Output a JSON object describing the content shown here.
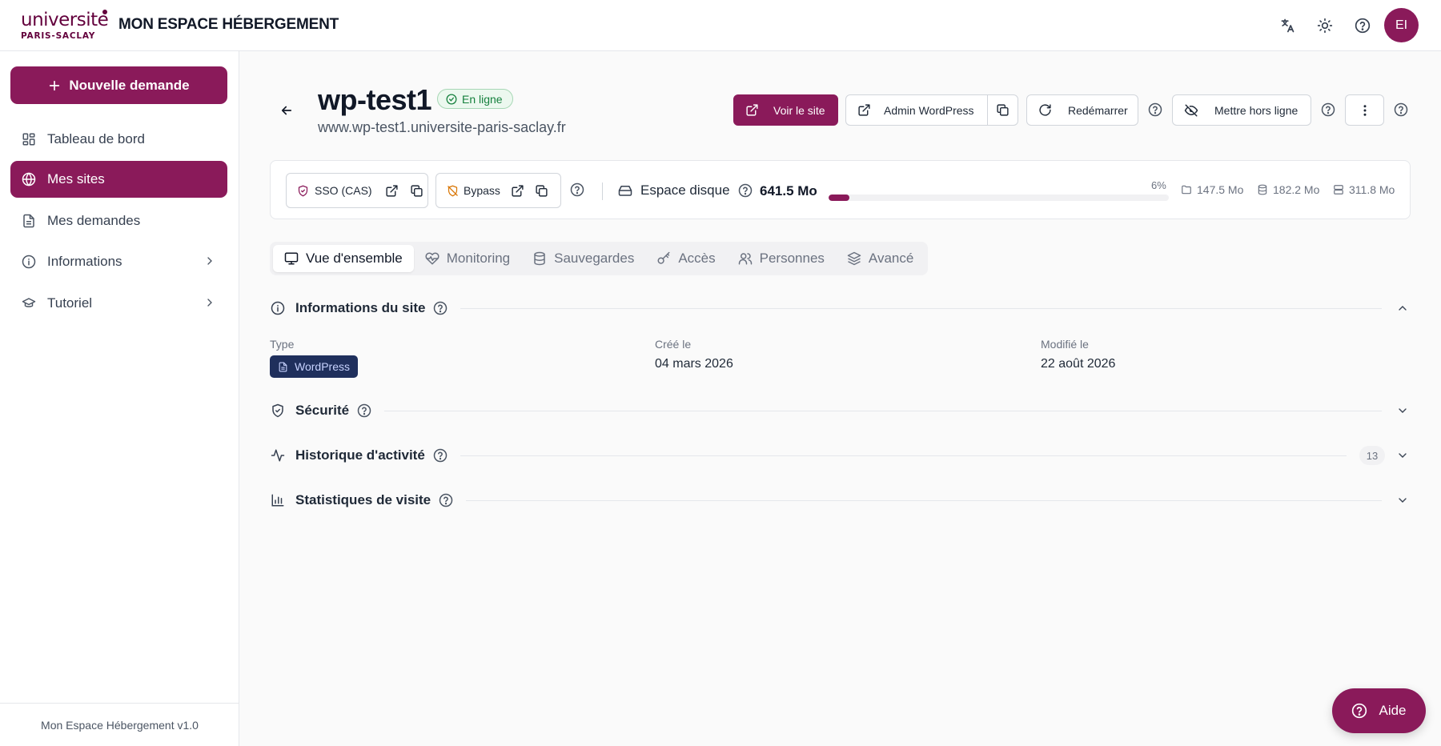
{
  "header": {
    "logo_top": "universite",
    "logo_bottom": "PARIS-SACLAY",
    "app_title": "MON ESPACE HÉBERGEMENT",
    "icons": [
      "translate-icon",
      "theme-icon",
      "help-icon"
    ],
    "avatar_initials": "EI"
  },
  "sidebar": {
    "new_request": "Nouvelle demande",
    "items": [
      {
        "label": "Tableau de bord",
        "icon": "dashboard-icon"
      },
      {
        "label": "Mes sites",
        "icon": "globe-icon",
        "active": true
      },
      {
        "label": "Mes demandes",
        "icon": "document-icon"
      },
      {
        "label": "Informations",
        "icon": "info-icon",
        "expandable": true
      },
      {
        "label": "Tutoriel",
        "icon": "graduation-icon",
        "expandable": true
      }
    ],
    "footer": "Mon Espace Hébergement v1.0"
  },
  "site": {
    "name": "wp-test1",
    "status": "En ligne",
    "url": "www.wp-test1.universite-paris-saclay.fr"
  },
  "actions": {
    "view_site": "Voir le site",
    "admin": "Admin WordPress",
    "restart": "Redémarrer",
    "offline": "Mettre hors ligne"
  },
  "infobar": {
    "sso_label": "SSO (CAS)",
    "bypass_label": "Bypass",
    "disk_label": "Espace disque",
    "disk_value": "641.5 Mo",
    "disk_percent_text": "6%",
    "disk_percent": 6,
    "files": "147.5 Mo",
    "database": "182.2 Mo",
    "backups": "311.8 Mo"
  },
  "tabs": [
    {
      "label": "Vue d'ensemble",
      "icon": "monitor-icon",
      "active": true
    },
    {
      "label": "Monitoring",
      "icon": "heart-pulse-icon"
    },
    {
      "label": "Sauvegardes",
      "icon": "database-icon"
    },
    {
      "label": "Accès",
      "icon": "key-icon"
    },
    {
      "label": "Personnes",
      "icon": "users-icon"
    },
    {
      "label": "Avancé",
      "icon": "layers-icon"
    }
  ],
  "sections": {
    "info": {
      "title": "Informations du site",
      "type_label": "Type",
      "type_value": "WordPress",
      "created_label": "Créé le",
      "created_value": "04 mars 2026",
      "modified_label": "Modifié le",
      "modified_value": "22 août 2026"
    },
    "security": {
      "title": "Sécurité"
    },
    "history": {
      "title": "Historique d'activité",
      "count": "13"
    },
    "stats": {
      "title": "Statistiques de visite"
    }
  },
  "fab": {
    "label": "Aide"
  },
  "colors": {
    "brand": "#8a1a5a",
    "success": "#15803d",
    "chip": "#1f2f5c"
  }
}
